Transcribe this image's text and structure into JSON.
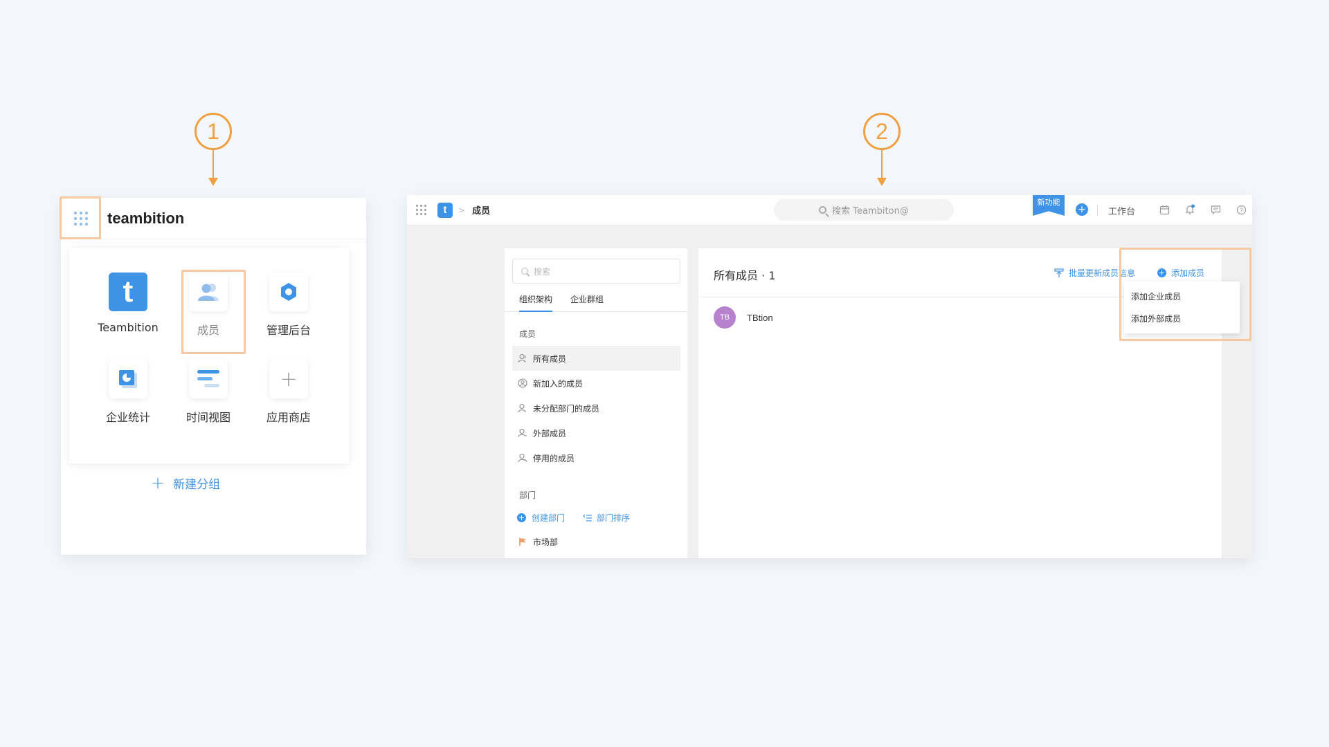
{
  "steps": {
    "first": "1",
    "second": "2"
  },
  "panel1": {
    "brand": "teambition",
    "apps": [
      {
        "label": "Teambition",
        "icon": "teambition-logo-icon"
      },
      {
        "label": "成员",
        "icon": "members-icon"
      },
      {
        "label": "管理后台",
        "icon": "admin-console-icon"
      },
      {
        "label": "企业统计",
        "icon": "statistics-icon"
      },
      {
        "label": "时间视图",
        "icon": "timeline-icon"
      },
      {
        "label": "应用商店",
        "icon": "plus-icon"
      }
    ],
    "new_group": "新建分组"
  },
  "panel2": {
    "topbar": {
      "app_letter": "t",
      "breadcrumb": "成员",
      "search_placeholder": "搜索 Teambiton@",
      "new_feature": "新功能",
      "workbench": "工作台"
    },
    "sidebar": {
      "search_placeholder": "搜索",
      "tabs": [
        "组织架构",
        "企业群组"
      ],
      "members_section": "成员",
      "items": [
        "所有成员",
        "新加入的成员",
        "未分配部门的成员",
        "外部成员",
        "停用的成员"
      ],
      "departments_section": "部门",
      "create_department": "创建部门",
      "sort_departments": "部门排序",
      "departments": [
        "市场部"
      ]
    },
    "main": {
      "title": "所有成员 · 1",
      "batch_update": "批量更新成员信息",
      "add_member": "添加成员",
      "members": [
        {
          "initials": "TB",
          "name": "TBtion"
        }
      ],
      "dropdown": [
        "添加企业成员",
        "添加外部成员"
      ]
    }
  },
  "colors": {
    "accent": "#3f93e6",
    "highlight": "#f7c9a0",
    "marker": "#f0a040",
    "avatar": "#b681cd"
  }
}
